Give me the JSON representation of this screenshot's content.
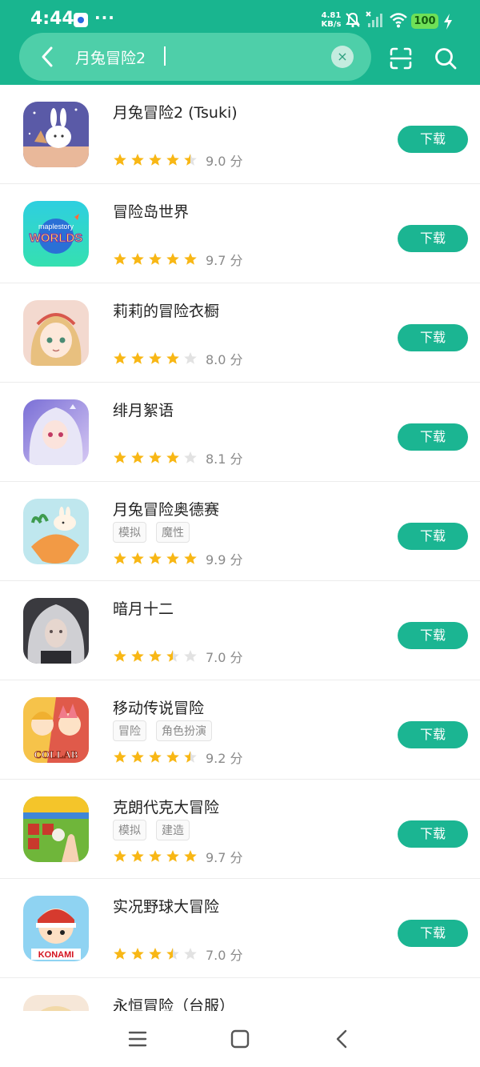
{
  "status_bar": {
    "time": "4:44",
    "dots": "···",
    "net_speed_value": "4.81",
    "net_speed_unit": "KB/s",
    "battery": "100"
  },
  "search": {
    "query": "月兔冒险2",
    "clear_symbol": "×"
  },
  "colors": {
    "brand": "#19b58f",
    "star": "#f8b715",
    "star_empty": "#e2e2e2"
  },
  "apps": [
    {
      "title": "月兔冒险2 (Tsuki)",
      "tags": [],
      "rating": 4.5,
      "score": "9.0 分",
      "button": "下载"
    },
    {
      "title": "冒险岛世界",
      "tags": [],
      "rating": 5,
      "score": "9.7 分",
      "button": "下载"
    },
    {
      "title": "莉莉的冒险衣橱",
      "tags": [],
      "rating": 4,
      "score": "8.0 分",
      "button": "下载"
    },
    {
      "title": "绯月絮语",
      "tags": [],
      "rating": 4,
      "score": "8.1 分",
      "button": "下载"
    },
    {
      "title": "月兔冒险奥德赛",
      "tags": [
        "模拟",
        "魔性"
      ],
      "rating": 5,
      "score": "9.9 分",
      "button": "下载"
    },
    {
      "title": "暗月十二",
      "tags": [],
      "rating": 3.5,
      "score": "7.0 分",
      "button": "下载"
    },
    {
      "title": "移动传说冒险",
      "tags": [
        "冒险",
        "角色扮演"
      ],
      "rating": 4.5,
      "score": "9.2 分",
      "button": "下载"
    },
    {
      "title": "克朗代克大冒险",
      "tags": [
        "模拟",
        "建造"
      ],
      "rating": 5,
      "score": "9.7 分",
      "button": "下载"
    },
    {
      "title": "实况野球大冒险",
      "tags": [],
      "rating": 3.5,
      "score": "7.0 分",
      "button": "下载"
    },
    {
      "title": "永恒冒险（台服）",
      "tags": [],
      "rating": null,
      "score": "",
      "button": ""
    }
  ],
  "icon_art": {
    "app-1": "icon-tsuki-rabbit",
    "app-2": "icon-maplestory-worlds",
    "app-3": "icon-lily-girl",
    "app-4": "icon-anime-girl",
    "app-5": "icon-tsuki-odyssey",
    "app-6": "icon-dark-moon",
    "app-7": "icon-collab-anime",
    "app-8": "icon-klondike-farm",
    "app-9": "icon-konami-baseball",
    "app-10": "icon-eternal-adventure"
  },
  "icon_text": {
    "maplestory_small": "maplestory",
    "maplestory_big": "WORLDS",
    "collab": "COLLAB",
    "konami": "KONAMI"
  }
}
